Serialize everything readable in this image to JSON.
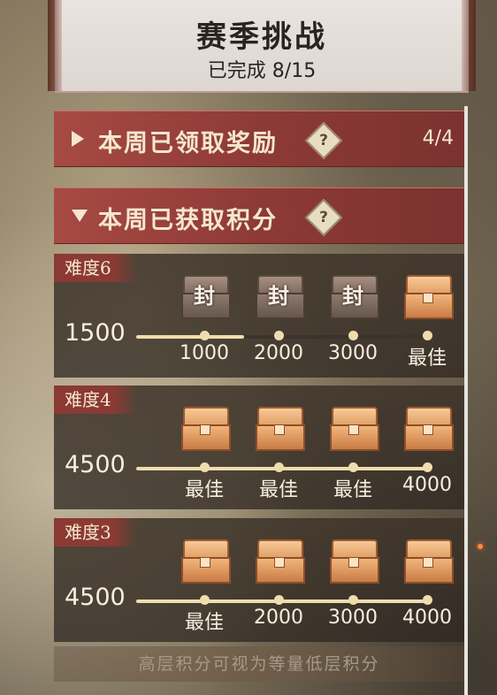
{
  "header": {
    "title": "赛季挑战",
    "progress": "已完成 8/15"
  },
  "sections": [
    {
      "label": "本周已领取奖励",
      "help": "?",
      "count": "4/4",
      "expanded": false
    },
    {
      "label": "本周已获取积分",
      "help": "?",
      "expanded": true
    }
  ],
  "tiers": [
    {
      "name": "难度6",
      "score": "1500",
      "fill_fraction": 0.37,
      "chests": [
        {
          "state": "sealed",
          "seal": "封",
          "label": "1000"
        },
        {
          "state": "sealed",
          "seal": "封",
          "label": "2000"
        },
        {
          "state": "sealed",
          "seal": "封",
          "label": "3000"
        },
        {
          "state": "open",
          "label": "最佳"
        }
      ]
    },
    {
      "name": "难度4",
      "score": "4500",
      "fill_fraction": 1.0,
      "chests": [
        {
          "state": "open",
          "label": "最佳"
        },
        {
          "state": "open",
          "label": "最佳"
        },
        {
          "state": "open",
          "label": "最佳"
        },
        {
          "state": "open",
          "label": "4000"
        }
      ]
    },
    {
      "name": "难度3",
      "score": "4500",
      "fill_fraction": 1.0,
      "chests": [
        {
          "state": "open",
          "label": "最佳"
        },
        {
          "state": "open",
          "label": "2000"
        },
        {
          "state": "open",
          "label": "3000"
        },
        {
          "state": "open",
          "label": "4000"
        }
      ]
    }
  ],
  "footer": {
    "note": "高层积分可视为等量低层积分"
  },
  "colors": {
    "accent_red": "#8d3a36",
    "cream": "#f4e6cf",
    "track_fill": "#f0ddae"
  }
}
